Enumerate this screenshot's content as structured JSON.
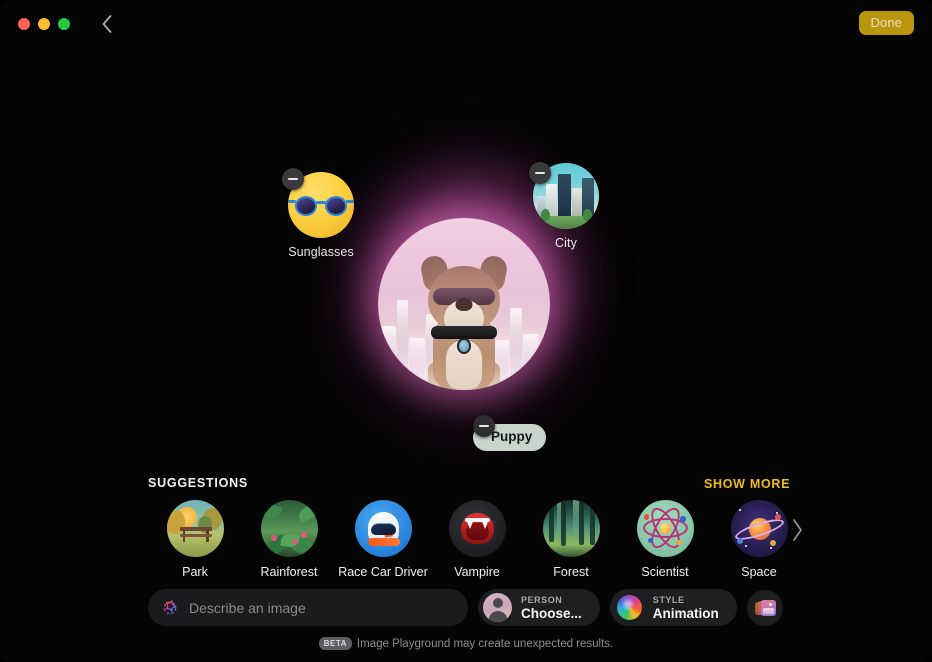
{
  "window": {
    "traffic_lights": [
      "close",
      "minimize",
      "zoom"
    ],
    "back_label": "Back",
    "done_label": "Done",
    "accent_done_bg": "#b9960e"
  },
  "canvas": {
    "hero": {
      "name": "generated-image",
      "description": "Puppy wearing sunglasses with a city skyline"
    },
    "concepts": [
      {
        "id": "sunglasses",
        "label": "Sunglasses",
        "remove_label": "Remove"
      },
      {
        "id": "city",
        "label": "City",
        "remove_label": "Remove"
      },
      {
        "id": "puppy",
        "label": "Puppy",
        "remove_label": "Remove"
      }
    ]
  },
  "suggestions": {
    "header": "SUGGESTIONS",
    "show_more": "SHOW MORE",
    "show_more_color": "#f2bb1c",
    "next_label": "Next",
    "items": [
      {
        "id": "park",
        "label": "Park"
      },
      {
        "id": "rainforest",
        "label": "Rainforest"
      },
      {
        "id": "race-car-driver",
        "label": "Race Car Driver"
      },
      {
        "id": "vampire",
        "label": "Vampire"
      },
      {
        "id": "forest",
        "label": "Forest"
      },
      {
        "id": "scientist",
        "label": "Scientist"
      },
      {
        "id": "space",
        "label": "Space"
      }
    ]
  },
  "toolbar": {
    "describe": {
      "value": "",
      "placeholder": "Describe an image",
      "icon": "apple-intelligence-sparkle-icon"
    },
    "person": {
      "key": "PERSON",
      "value": "Choose...",
      "icon": "person-avatar-icon"
    },
    "style": {
      "key": "STYLE",
      "value": "Animation",
      "icon": "style-sphere-icon"
    },
    "photos": {
      "label": "Photos",
      "icon": "photos-stack-icon"
    }
  },
  "footer": {
    "badge": "BETA",
    "text": "Image Playground may create unexpected results."
  }
}
